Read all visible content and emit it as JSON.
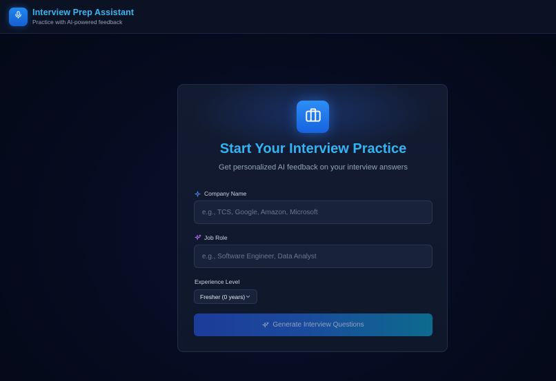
{
  "header": {
    "title": "Interview Prep Assistant",
    "subtitle": "Practice with AI-powered feedback",
    "logo_icon": "microphone-icon"
  },
  "card": {
    "icon": "briefcase-icon",
    "title": "Start Your Interview Practice",
    "subtitle": "Get personalized AI feedback on your interview answers",
    "company": {
      "label": "Company Name",
      "icon": "sparkle-icon",
      "placeholder": "e.g., TCS, Google, Amazon, Microsoft",
      "value": ""
    },
    "role": {
      "label": "Job Role",
      "icon": "sparkles-icon",
      "placeholder": "e.g., Software Engineer, Data Analyst",
      "value": ""
    },
    "experience": {
      "label": "Experience Level",
      "selected": "Fresher (0 years)"
    },
    "generate_button": {
      "label": "Generate Interview Questions",
      "icon": "sparkles-icon"
    }
  },
  "colors": {
    "accent": "#33b4f2",
    "primary_blue": "#1e88f0",
    "background": "#060b1f",
    "card": "#121b31"
  }
}
